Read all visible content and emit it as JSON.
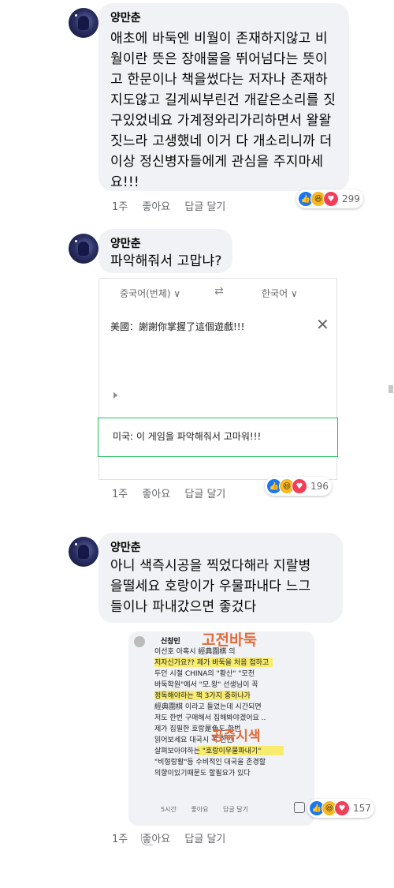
{
  "comment1": {
    "author": "양만춘",
    "lines": [
      "애초에 바둑엔 비월이 존재하지않고 비",
      "월이란 뜻은 장애물을 뛰어넘다는 뜻이",
      "고 한문이나 책을썼다는 저자나 존재하",
      "지도않고 길게씨부린건 개같은소리를 짓",
      "구있었네요 가계정와리가리하면서 왈왈",
      "짓느라 고생했네 이거 다 개소리니까 더",
      "이상 정신병자들에게 관심을 주지마세",
      "요!!!"
    ],
    "time": "1주",
    "like": "좋아요",
    "reply": "답글 달기",
    "reactions": [
      "like",
      "haha",
      "love"
    ],
    "reaction_count": "299"
  },
  "comment2": {
    "author": "양만춘",
    "text": "파악해줘서 고맙냐?",
    "translator": {
      "source_lang": "중국어(번체)",
      "target_lang": "한국어",
      "swap_icon": "⇄",
      "source_text": "美國：謝謝你掌握了這個遊戲!!!",
      "close_icon": "✕",
      "speaker_icon": "🕨",
      "result_text": "미국: 이 게임을 파악해줘서 고마워!!!"
    },
    "time": "1주",
    "like": "좋아요",
    "reply": "답글 달기",
    "reaction_count": "196"
  },
  "comment3": {
    "author": "양만춘",
    "lines": [
      "아니 색즉시공을 찍었다해라 지랄병",
      "을떨세요 호랑이가 우물파내다 느그",
      "들이나 파내갔으면 좋겄다"
    ],
    "embedded": {
      "author": "신창민",
      "lines": [
        "이선호 아혹시 經典圍棋 의",
        "저자신가요?? 제가 바둑을 처음 접하고",
        "두던 시절 CHINA의 \"황산\" \"모천",
        "바둑학원\"에서 \"모.왕\" 선생님이 꼭",
        "정독해야하는 책 3가지 중하나가",
        "經典圍棋 이라고 들었는데 시간되면",
        "저도 한번 구매해서 집해봐야겠어요 ..",
        "제가 집필한 호랑是色도 한번",
        "읽어보세요 대국시 꼭 한번",
        "살펴보아야하는 \"호랑이우물파내기\"",
        "\"비형랑활\"등 수비적인 대국을 존경할",
        "의향이있기때문도 할필요가 있다"
      ],
      "annotation_top": "고전바둑",
      "annotation_mid": "공즉시색",
      "time": "5시간",
      "like": "좋아요",
      "reply": "답글 달기"
    },
    "time": "1주",
    "like": "좋아요",
    "reply": "답글 달기",
    "reaction_count": "157"
  }
}
